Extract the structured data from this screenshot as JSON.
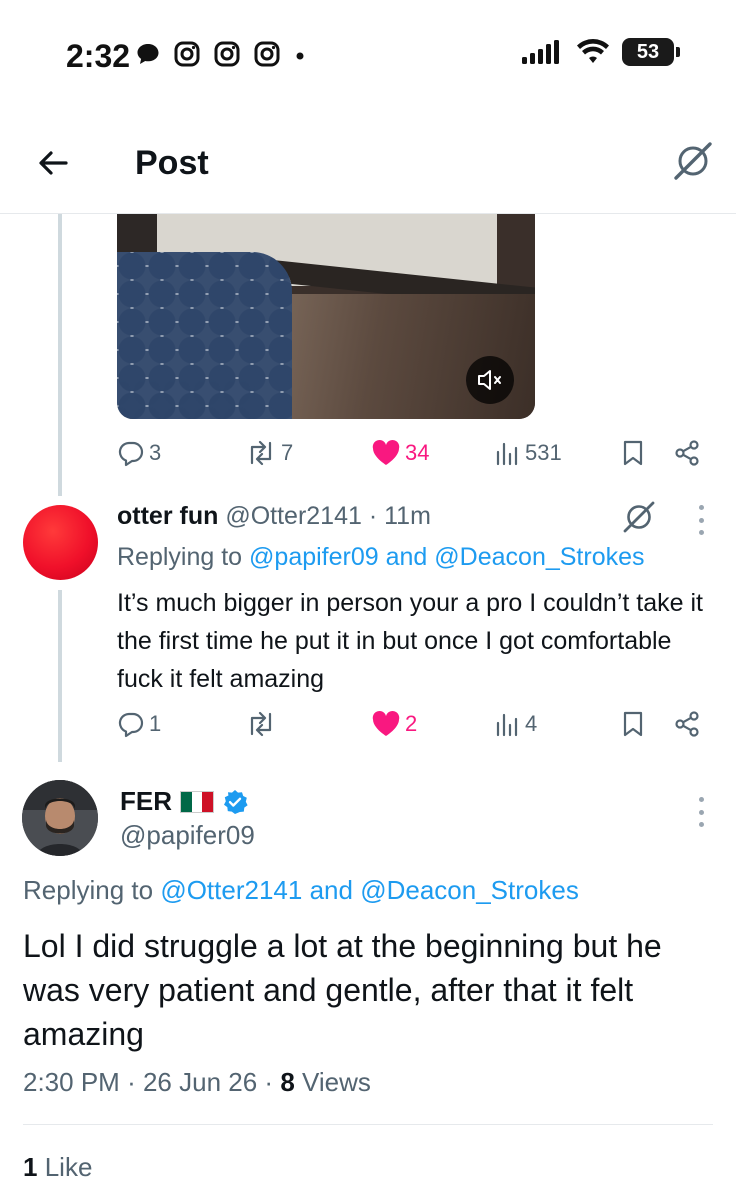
{
  "status_bar": {
    "time": "2:32",
    "battery": "53"
  },
  "header": {
    "title": "Post"
  },
  "parent_stats": {
    "replies": "3",
    "reposts": "7",
    "likes": "34",
    "views": "531"
  },
  "reply": {
    "name": "otter fun",
    "handle": "@Otter2141",
    "time": "11m",
    "replying_prefix": "Replying to",
    "replying_to_1": "@papifer09",
    "replying_join": "and",
    "replying_to_2": "@Deacon_Strokes",
    "text": "It’s much bigger in person your a pro I couldn’t take it the first time he put it in but once I got comfortable fuck it felt amazing",
    "stats": {
      "replies": "1",
      "likes": "2",
      "views": "4"
    }
  },
  "post": {
    "name": "FER",
    "handle": "@papifer09",
    "replying_prefix": "Replying to",
    "replying_to_1": "@Otter2141",
    "replying_join": "and",
    "replying_to_2": "@Deacon_Strokes",
    "text": "Lol I did struggle a lot at the beginning but he was very patient and gentle, after that it felt amazing",
    "time": "2:30 PM",
    "date": "26 Jun 26",
    "views_count": "8",
    "views_label": "Views",
    "likes_count": "1",
    "likes_label": "Like"
  },
  "colors": {
    "accent": "#1d9bf0",
    "like": "#f91880",
    "muted": "#536471"
  },
  "icons": [
    "back-arrow-icon",
    "grok-icon",
    "mute-icon",
    "reply-icon",
    "repost-icon",
    "heart-icon",
    "views-icon",
    "bookmark-icon",
    "share-icon",
    "verified-icon",
    "more-icon"
  ]
}
